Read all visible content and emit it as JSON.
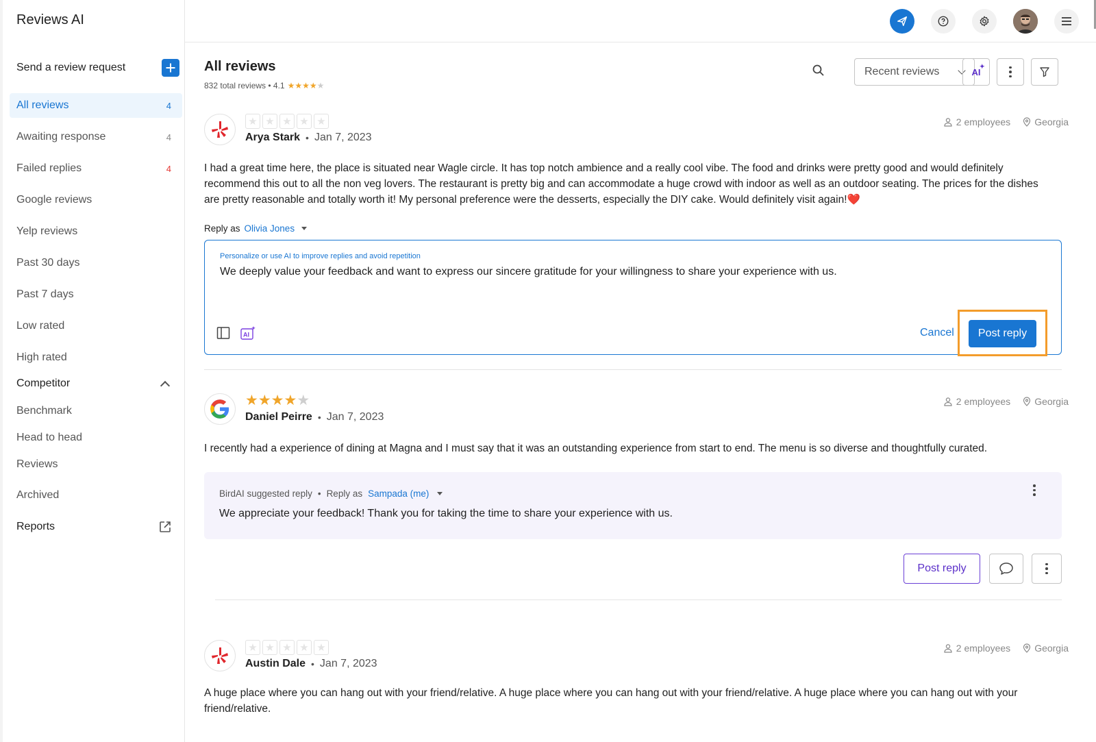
{
  "app": {
    "title": "Reviews AI"
  },
  "sidebar": {
    "send_request": "Send a review request",
    "items": [
      {
        "label": "All reviews",
        "count": "4"
      },
      {
        "label": "Awaiting response",
        "count": "4"
      },
      {
        "label": "Failed replies",
        "count": "4"
      },
      {
        "label": "Google reviews",
        "count": ""
      },
      {
        "label": "Yelp reviews",
        "count": ""
      },
      {
        "label": "Past 30 days",
        "count": ""
      },
      {
        "label": "Past 7 days",
        "count": ""
      },
      {
        "label": "Low rated",
        "count": ""
      },
      {
        "label": "High rated",
        "count": ""
      }
    ],
    "competitor": {
      "label": "Competitor",
      "items": [
        "Benchmark",
        "Head to head",
        "Reviews"
      ]
    },
    "archived": "Archived",
    "reports": "Reports"
  },
  "header": {
    "icons": [
      "send-icon",
      "help-icon",
      "gear-icon",
      "avatar",
      "menu-icon"
    ],
    "accent": "#1976d2"
  },
  "main": {
    "title": "All reviews",
    "summary": "832 total reviews • 4.1",
    "summary_rating": 4.1,
    "sort": "Recent reviews",
    "ai_label": "AI"
  },
  "reviews": [
    {
      "source": "yelp",
      "rating": 0,
      "name": "Arya Stark",
      "date": "Jan 7, 2023",
      "employees": "2 employees",
      "location": "Georgia",
      "text": "I had a great time here, the place is situated near Wagle circle. It has top notch ambience and a really cool vibe. The food and drinks were pretty good and would definitely recommend this out to all the non veg lovers. The restaurant is pretty big and can accommodate a huge crowd with indoor as well as an outdoor seating. The prices for the dishes are pretty reasonable and totally worth it! My personal preference were the desserts, especially the DIY cake. Would definitely visit again!❤️",
      "reply_as_label": "Reply as",
      "reply_as_name": "Olivia Jones",
      "reply_hint": "Personalize or use AI to improve replies and avoid repetition",
      "reply_text": "We deeply value your feedback and want to express our sincere gratitude for your willingness to share your experience with us.",
      "cancel": "Cancel",
      "post": "Post reply"
    },
    {
      "source": "google",
      "rating": 4,
      "name": "Daniel Peirre",
      "date": "Jan 7, 2023",
      "employees": "2 employees",
      "location": "Georgia",
      "text": "I recently had a experience of dining at Magna and I must say that it was an outstanding experience from start to end. The menu is so diverse and thoughtfully curated.",
      "suggest_label": "BirdAI suggested reply",
      "reply_as_label": "Reply as",
      "reply_as_name": "Sampada (me)",
      "suggest_text": "We appreciate your feedback! Thank you for taking the time to share your experience with us.",
      "post": "Post reply"
    },
    {
      "source": "yelp",
      "rating": 0,
      "name": "Austin Dale",
      "date": "Jan 7, 2023",
      "employees": "2 employees",
      "location": "Georgia",
      "text": "A huge place where you can hang out with your friend/relative. A huge place where you can hang out with your friend/relative. A huge place where you can hang out with your friend/relative."
    }
  ]
}
